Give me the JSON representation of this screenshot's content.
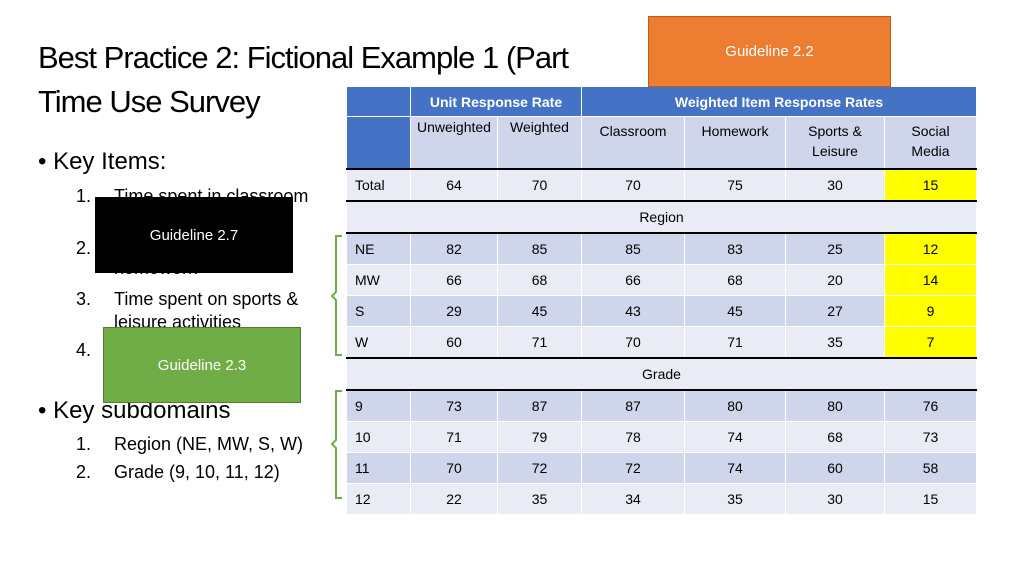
{
  "title_line1": "Best Practice 2: Fictional Example 1 (Part",
  "title_line2": "Time Use Survey",
  "key_items": {
    "heading": "Key Items:",
    "items": [
      {
        "num": "1.",
        "text": "Time spent in classroom"
      },
      {
        "num": "2.",
        "text": "homework"
      },
      {
        "num": "3.",
        "text": "Time spent on sports &"
      },
      {
        "num": "",
        "text": "leisure activities"
      },
      {
        "num": "4.",
        "text": ""
      }
    ]
  },
  "key_subdomains": {
    "heading": "Key subdomains",
    "items": [
      {
        "num": "1.",
        "text": "Region (NE, MW, S, W)"
      },
      {
        "num": "2.",
        "text": "Grade (9, 10, 11, 12)"
      }
    ]
  },
  "callouts": {
    "g22": {
      "label": "Guideline 2.2",
      "color": "#ed7d31"
    },
    "g27": {
      "label": "Guideline 2.7",
      "color": "#000000"
    },
    "g23": {
      "label": "Guideline 2.3",
      "color": "#70ad47"
    }
  },
  "table": {
    "group_headers": [
      "Unit Response Rate",
      "Weighted Item Response Rates"
    ],
    "columns": [
      "Unweighted",
      "Weighted",
      "Classroom",
      "Homework",
      "Sports & Leisure",
      "Social Media"
    ],
    "total": {
      "label": "Total",
      "values": [
        "64",
        "70",
        "70",
        "75",
        "30",
        "15"
      ]
    },
    "region_label": "Region",
    "region_rows": [
      {
        "label": "NE",
        "values": [
          "82",
          "85",
          "85",
          "83",
          "25",
          "12"
        ]
      },
      {
        "label": "MW",
        "values": [
          "66",
          "68",
          "66",
          "68",
          "20",
          "14"
        ]
      },
      {
        "label": "S",
        "values": [
          "29",
          "45",
          "43",
          "45",
          "27",
          "9"
        ]
      },
      {
        "label": "W",
        "values": [
          "60",
          "71",
          "70",
          "71",
          "35",
          "7"
        ]
      }
    ],
    "grade_label": "Grade",
    "grade_rows": [
      {
        "label": "9",
        "values": [
          "73",
          "87",
          "87",
          "80",
          "80",
          "76"
        ]
      },
      {
        "label": "10",
        "values": [
          "71",
          "79",
          "78",
          "74",
          "68",
          "73"
        ]
      },
      {
        "label": "11",
        "values": [
          "70",
          "72",
          "72",
          "74",
          "60",
          "58"
        ]
      },
      {
        "label": "12",
        "values": [
          "22",
          "35",
          "34",
          "35",
          "30",
          "15"
        ]
      }
    ],
    "highlight_color": "#ffff00",
    "header_color": "#4472c4"
  }
}
